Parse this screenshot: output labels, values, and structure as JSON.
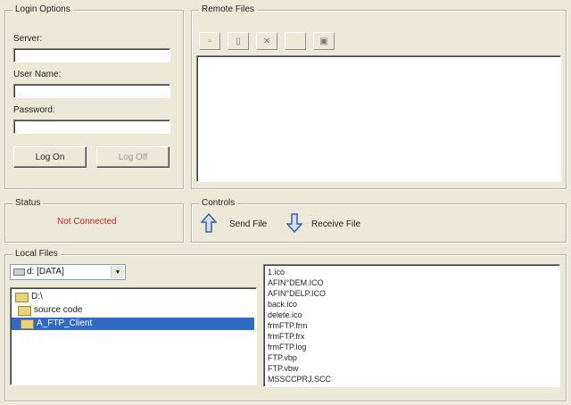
{
  "login": {
    "legend": "Login Options",
    "server_label": "Server:",
    "server_value": "",
    "username_label": "User Name:",
    "username_value": "",
    "password_label": "Password:",
    "password_value": "",
    "logon_label": "Log On",
    "logoff_label": "Log Off"
  },
  "remote": {
    "legend": "Remote Files",
    "toolbar_icons": [
      "upload-icon",
      "folder-icon",
      "delete-icon",
      "blank-icon",
      "refresh-icon"
    ],
    "toolbar_glyphs": [
      "▫",
      "▯",
      "✕",
      "",
      "▣"
    ]
  },
  "status": {
    "legend": "Status",
    "text": "Not Connected",
    "text_color": "#c8281e"
  },
  "controls": {
    "legend": "Controls",
    "send_label": "Send File",
    "receive_label": "Receive File",
    "accent": "#3a5fa8"
  },
  "local": {
    "legend": "Local Files",
    "drive": "d: [DATA]",
    "dirs": [
      {
        "label": "D:\\",
        "selected": false
      },
      {
        "label": "source code",
        "selected": false
      },
      {
        "label": "A_FTP_Client",
        "selected": true
      }
    ],
    "files": [
      "1.ico",
      "AFIN°DEM.ICO",
      "AFIN°DELP.ICO",
      "back.ico",
      "delete.ico",
      "frmFTP.frm",
      "frmFTP.frx",
      "frmFTP.log",
      "FTP.vbp",
      "FTP.vbw",
      "MSSCCPRJ.SCC"
    ]
  }
}
